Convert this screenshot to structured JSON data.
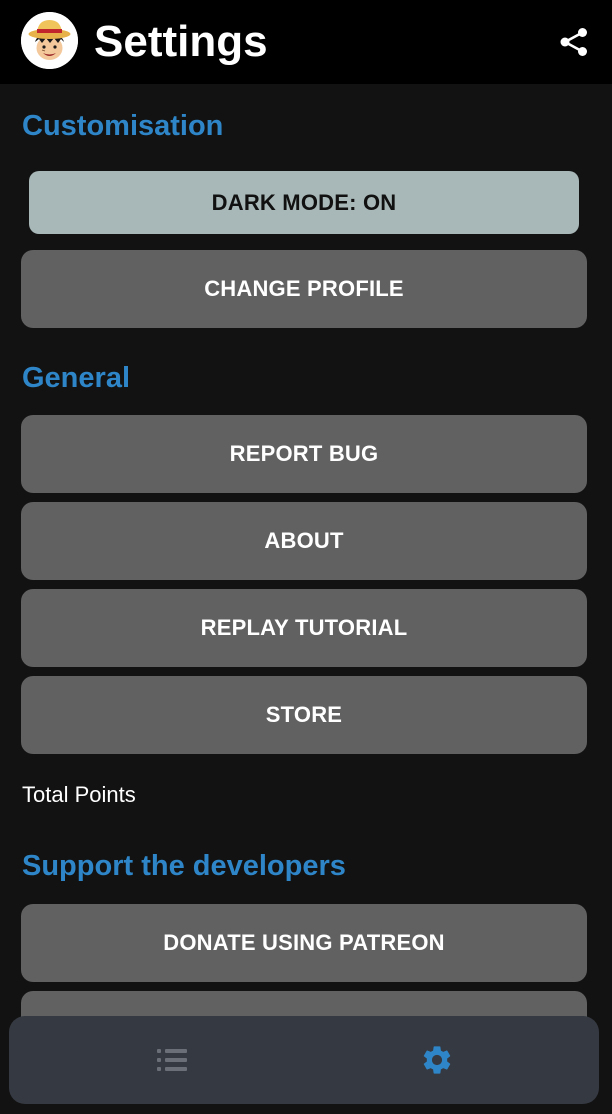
{
  "header": {
    "title": "Settings",
    "avatar_icon": "straw-hat-character-avatar",
    "share_icon": "share-icon"
  },
  "sections": {
    "customisation": {
      "title": "Customisation",
      "dark_mode_label": "DARK MODE: ON",
      "change_profile_label": "CHANGE PROFILE"
    },
    "general": {
      "title": "General",
      "report_bug_label": "REPORT BUG",
      "about_label": "ABOUT",
      "replay_tutorial_label": "REPLAY TUTORIAL",
      "store_label": "STORE"
    },
    "total_points_label": "Total Points",
    "support": {
      "title": "Support the developers",
      "donate_patreon_label": "DONATE USING PATREON"
    }
  },
  "bottom_nav": {
    "items": [
      {
        "icon": "list-icon",
        "active": false
      },
      {
        "icon": "gear-icon",
        "active": true
      }
    ]
  },
  "colors": {
    "accent": "#2e86c8",
    "button_bg": "#616161",
    "toggle_bg": "#a8b7b7",
    "nav_bg": "#353941",
    "nav_inactive": "#6b6f77"
  }
}
